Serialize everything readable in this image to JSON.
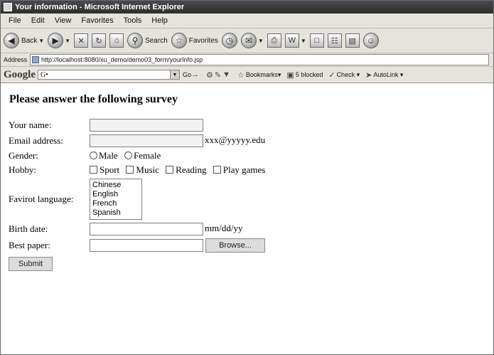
{
  "window": {
    "title": "Your information - Microsoft Internet Explorer"
  },
  "menu": [
    "File",
    "Edit",
    "View",
    "Favorites",
    "Tools",
    "Help"
  ],
  "toolbar": {
    "back_label": "Back",
    "search_label": "Search",
    "favorites_label": "Favorites"
  },
  "address": {
    "label": "Address",
    "url": "http://localhost:8080/xu_demo/demo03_form/yourInfo.jsp"
  },
  "google_bar": {
    "logo": "Google",
    "search_value": "G•",
    "go_label": "Go",
    "bookmarks_label": "Bookmarks▾",
    "blocked_label": "5 blocked",
    "check_label": "Check ▾",
    "autolink_label": "AutoLink ▾"
  },
  "page": {
    "title": "Please answer the following survey",
    "fields": {
      "name_label": "Your name:",
      "email_label": "Email address:",
      "email_hint": "xxx@yyyyy.edu",
      "gender_label": "Gender:",
      "gender_options": [
        "Male",
        "Female"
      ],
      "hobby_label": "Hobby:",
      "hobby_options": [
        "Sport",
        "Music",
        "Reading",
        "Play games"
      ],
      "language_label": "Favirot language:",
      "language_options": [
        "Chinese",
        "English",
        "French",
        "Spanish"
      ],
      "birth_label": "Birth date:",
      "birth_hint": "mm/dd/yy",
      "paper_label": "Best paper:",
      "browse_label": "Browse...",
      "submit_label": "Submit"
    }
  }
}
